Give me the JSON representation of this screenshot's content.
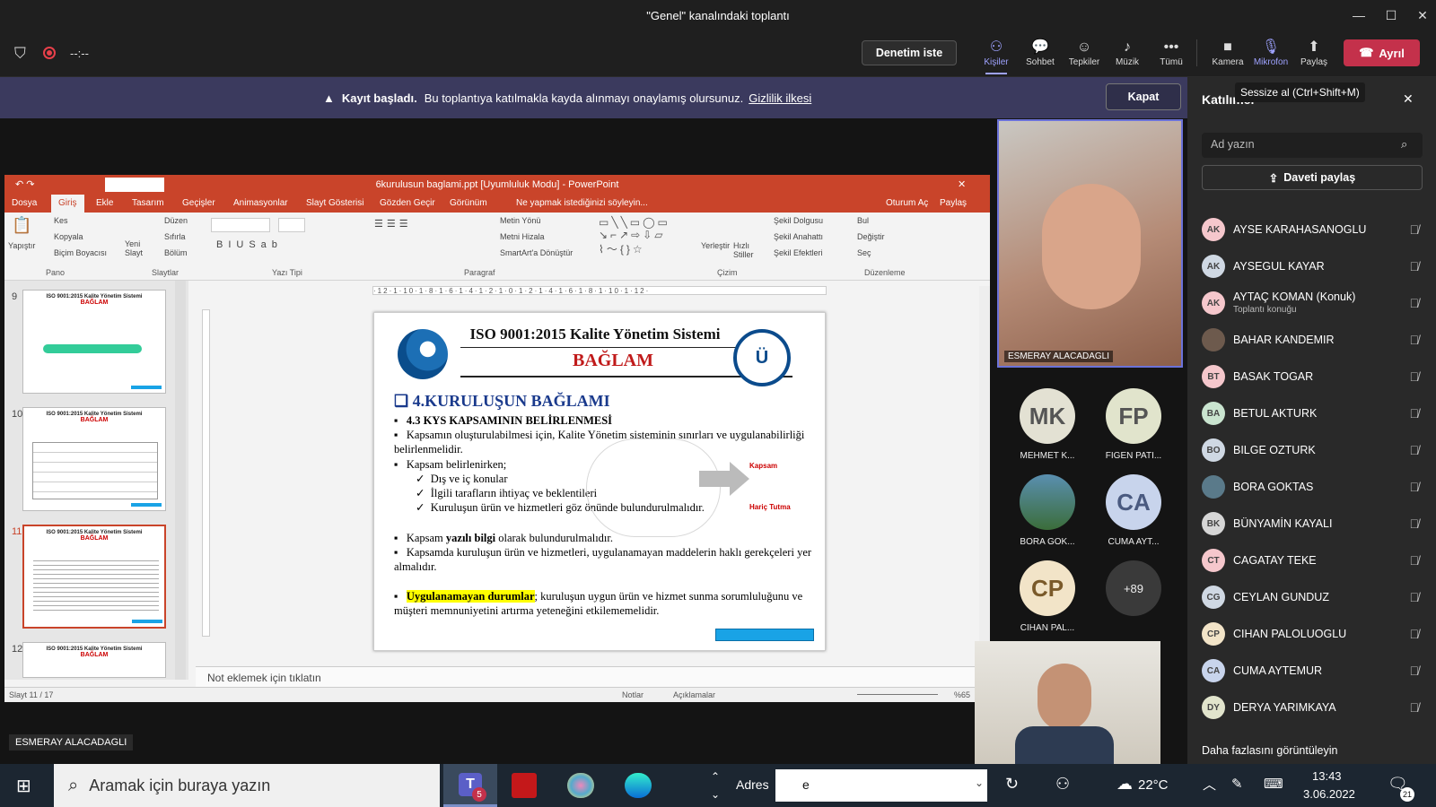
{
  "window": {
    "title": "\"Genel\" kanalındaki toplantı",
    "minimize": "—",
    "maximize": "☐",
    "close": "✕"
  },
  "toolbar": {
    "timer": "--:--",
    "request_control": "Denetim iste",
    "people": "Kişiler",
    "chat": "Sohbet",
    "reactions": "Tepkiler",
    "music": "Müzik",
    "more": "Tümü",
    "camera": "Kamera",
    "mic": "Mikrofon",
    "share": "Paylaş",
    "leave": "Ayrıl"
  },
  "banner": {
    "title": "Kayıt başladı.",
    "text": "Bu toplantıya katılmakla kayda alınmayı onaylamış olursunuz.",
    "link": "Gizlilik ilkesi",
    "close": "Kapat"
  },
  "tooltip": "Sessize al (Ctrl+Shift+M)",
  "ppt": {
    "title": "6kurulusun baglami.ppt [Uyumluluk Modu] - PowerPoint",
    "tabs": [
      "Dosya",
      "Giriş",
      "Ekle",
      "Tasarım",
      "Geçişler",
      "Animasyonlar",
      "Slayt Gösterisi",
      "Gözden Geçir",
      "Görünüm",
      "Ne yapmak istediğinizi söyleyin..."
    ],
    "signin": "Oturum Aç",
    "share": "Paylaş",
    "ribbon": {
      "paste": "Yapıştır",
      "cut": "Kes",
      "copy": "Kopyala",
      "painter": "Biçim Boyacısı",
      "new_slide": "Yeni Slayt",
      "layout": "Düzen",
      "reset": "Sıfırla",
      "section": "Bölüm",
      "text_dir": "Metin Yönü",
      "align_text": "Metni Hizala",
      "smartart": "SmartArt'a Dönüştür",
      "arrange": "Yerleştir",
      "quick_styles": "Hızlı Stiller",
      "shape_fill": "Şekil Dolgusu",
      "shape_outline": "Şekil Anahattı",
      "shape_effects": "Şekil Efektleri",
      "find": "Bul",
      "replace": "Değiştir",
      "select": "Seç",
      "groups": [
        "Pano",
        "Slaytlar",
        "Yazı Tipi",
        "Paragraf",
        "Çizim",
        "Düzenleme"
      ]
    },
    "thumbs": [
      "9",
      "10",
      "11",
      "12"
    ],
    "thumb_title": "ISO 9001:2015 Kalite Yönetim Sistemi",
    "thumb_sub": "BAĞLAM",
    "slide": {
      "title": "ISO 9001:2015 Kalite Yönetim Sistemi",
      "subtitle": "BAĞLAM",
      "heading": "4.KURULUŞUN BAĞLAMI",
      "subheading": "4.3 KYS KAPSAMININ BELİRLENMESİ",
      "b1": "Kapsamın oluşturulabilmesi için, Kalite Yönetim sisteminin sınırları ve uygulanabilirliği belirlenmelidir.",
      "b2": "Kapsam belirlenirken;",
      "c1": "Dış ve iç konular",
      "c2": "İlgili tarafların ihtiyaç ve beklentileri",
      "c3": "Kuruluşun ürün ve hizmetleri göz önünde bulundurulmalıdır.",
      "b3a": "Kapsam ",
      "b3b": "yazılı bilgi",
      "b3c": " olarak bulundurulmalıdır.",
      "b4": "Kapsamda kuruluşun ürün ve hizmetleri, uygulanamayan maddelerin haklı gerekçeleri yer almalıdır.",
      "b5a": "Uygulanamayan durumlar",
      "b5b": "; kuruluşun uygun ürün ve hizmet sunma sorumluluğunu ve müşteri memnuniyetini artırma yeteneğini etkilememelidir.",
      "kapsam": "Kapsam",
      "haric": "Hariç Tutma"
    },
    "notes": "Not eklemek için tıklatın",
    "status": {
      "slide": "Slayt 11 / 17",
      "notes": "Notlar",
      "comments": "Açıklamalar",
      "zoom": "%65"
    }
  },
  "presenter_label": "ESMERAY ALACADAGLI",
  "video_main": "ESMERAY ALACADAGLI",
  "tiles": [
    {
      "initials": "MK",
      "name": "MEHMET K..."
    },
    {
      "initials": "FP",
      "name": "FIGEN PATI..."
    },
    {
      "initials": "",
      "name": "BORA GOK..."
    },
    {
      "initials": "CA",
      "name": "CUMA AYT..."
    },
    {
      "initials": "CP",
      "name": "CIHAN PAL..."
    },
    {
      "initials": "+89",
      "name": ""
    }
  ],
  "panel": {
    "title": "Katılımcı",
    "search_placeholder": "Ad yazın",
    "invite": "Daveti paylaş",
    "more": "Daha fazlasını görüntüleyin",
    "people": [
      {
        "i": "AK",
        "n": "AYSE KARAHASANOGLU",
        "s": ""
      },
      {
        "i": "AK",
        "n": "AYSEGUL KAYAR",
        "s": ""
      },
      {
        "i": "AK",
        "n": "AYTAÇ KOMAN (Konuk)",
        "s": "Toplantı konuğu"
      },
      {
        "i": "",
        "n": "BAHAR KANDEMIR",
        "s": ""
      },
      {
        "i": "BT",
        "n": "BASAK TOGAR",
        "s": ""
      },
      {
        "i": "BA",
        "n": "BETUL AKTURK",
        "s": ""
      },
      {
        "i": "BO",
        "n": "BILGE OZTURK",
        "s": ""
      },
      {
        "i": "",
        "n": "BORA GOKTAS",
        "s": ""
      },
      {
        "i": "BK",
        "n": "BÜNYAMİN KAYALI",
        "s": ""
      },
      {
        "i": "CT",
        "n": "CAGATAY TEKE",
        "s": ""
      },
      {
        "i": "CG",
        "n": "CEYLAN GUNDUZ",
        "s": ""
      },
      {
        "i": "CP",
        "n": "CIHAN PALOLUOGLU",
        "s": ""
      },
      {
        "i": "CA",
        "n": "CUMA AYTEMUR",
        "s": ""
      },
      {
        "i": "DY",
        "n": "DERYA YARIMKAYA",
        "s": ""
      }
    ]
  },
  "taskbar": {
    "search": "Aramak için buraya yazın",
    "address_label": "Adres",
    "address_value": "e",
    "temp": "22°C",
    "time": "13:43",
    "date": "3.06.2022",
    "notif": "21",
    "teams_badge": "5"
  }
}
